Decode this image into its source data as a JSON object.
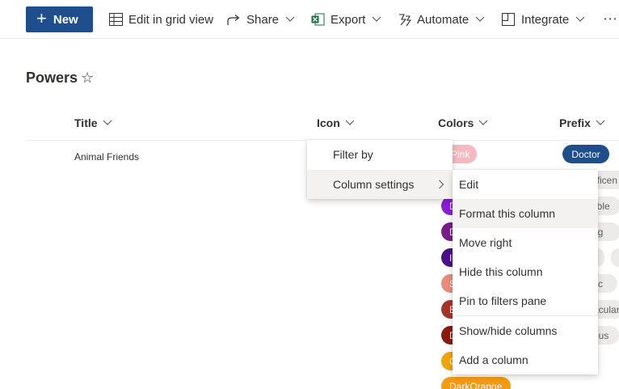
{
  "commandbar": {
    "new_label": "New",
    "edit_grid_label": "Edit in grid view",
    "share_label": "Share",
    "export_label": "Export",
    "automate_label": "Automate",
    "integrate_label": "Integrate",
    "more_label": "⋯"
  },
  "page": {
    "title": "Powers",
    "star": "☆"
  },
  "columns": {
    "title": "Title",
    "icon": "Icon",
    "colors": "Colors",
    "prefix": "Prefix"
  },
  "row": {
    "title": "Animal Friends",
    "colors_first": "Pink",
    "colors_bottom": "DarkOrange",
    "prefix_first": "Doctor",
    "prefix_partial": [
      "ificen",
      "ible",
      "ng",
      "",
      "tic",
      "acular",
      "ous"
    ]
  },
  "color_pills": [
    {
      "label": "D",
      "color": "#8b1fd6"
    },
    {
      "label": "D",
      "color": "#7a1b8a"
    },
    {
      "label": "I",
      "color": "#4b0f8a"
    },
    {
      "label": "S",
      "color": "#ea8c7b"
    },
    {
      "label": "B",
      "color": "#a8322a"
    },
    {
      "label": "D",
      "color": "#8b1a10"
    },
    {
      "label": "G",
      "color": "#f0a500"
    }
  ],
  "menu_primary": {
    "items": [
      "Filter by",
      "Column settings"
    ],
    "highlighted": "Column settings"
  },
  "menu_secondary": {
    "items": [
      "Edit",
      "Format this column",
      "Move right",
      "Hide this column",
      "Pin to filters pane",
      "Show/hide columns",
      "Add a column"
    ],
    "highlighted": "Format this column"
  },
  "colors": {
    "primary_button": "#1f4e8c",
    "excel_green": "#1d6f42",
    "menu_highlight": "#f3f2f1"
  }
}
